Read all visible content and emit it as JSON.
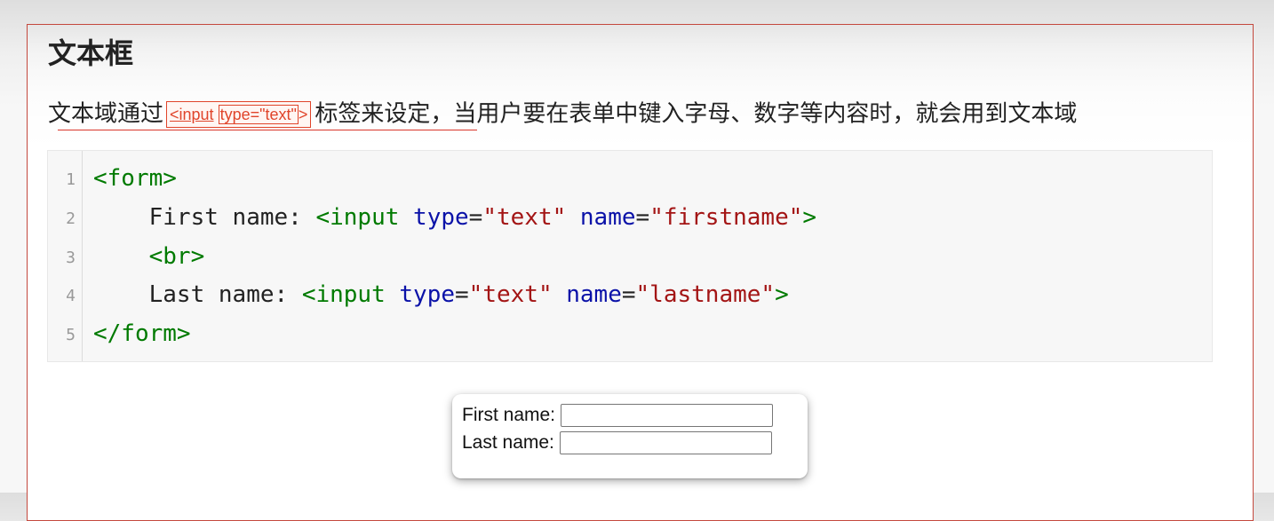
{
  "heading": "文本框",
  "description": {
    "prefix": "文本域通过",
    "chip_part1": "<input",
    "chip_part2": "type=\"text\"",
    "chip_part3": ">",
    "suffix": "标签来设定，当用户要在表单中键入字母、数字等内容时，就会用到文本域"
  },
  "code": {
    "line_numbers": [
      "1",
      "2",
      "3",
      "4",
      "5"
    ],
    "line1": {
      "tag": "<form>"
    },
    "line2": {
      "indent": "    ",
      "text": "First name: ",
      "tag_open": "<input",
      "attr1": "type",
      "eq1": "=",
      "val1": "\"text\"",
      "attr2": "name",
      "eq2": "=",
      "val2": "\"firstname\"",
      "tag_close": ">"
    },
    "line3": {
      "indent": "    ",
      "tag": "<br>"
    },
    "line4": {
      "indent": "    ",
      "text": "Last name: ",
      "tag_open": "<input",
      "attr1": "type",
      "eq1": "=",
      "val1": "\"text\"",
      "attr2": "name",
      "eq2": "=",
      "val2": "\"lastname\"",
      "tag_close": ">"
    },
    "line5": {
      "tag": "</form>"
    }
  },
  "form_preview": {
    "first_label": "First name:",
    "first_value": "",
    "last_label": "Last name:",
    "last_value": ""
  },
  "colors": {
    "accent_red": "#c4483d",
    "tag_green": "#007a00",
    "attr_blue": "#0b12a8",
    "string_red": "#a31515"
  }
}
